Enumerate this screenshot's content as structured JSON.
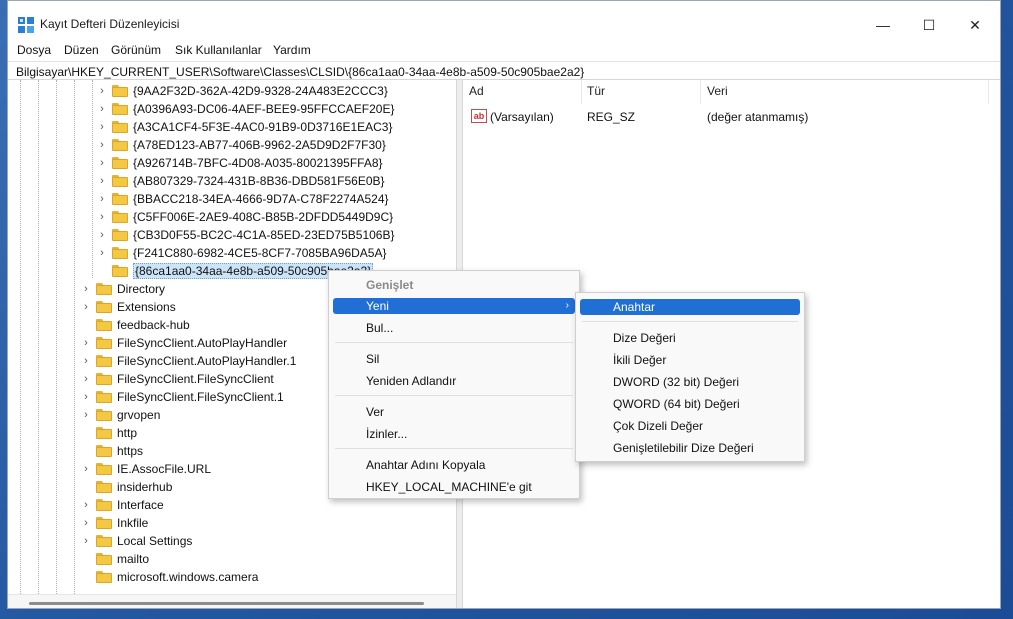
{
  "window": {
    "title": "Kayıt Defteri Düzenleyicisi"
  },
  "controls": {
    "minimize": "—",
    "maximize": "☐",
    "close": "✕"
  },
  "menu": [
    "Dosya",
    "Düzen",
    "Görünüm",
    "Sık Kullanılanlar",
    "Yardım"
  ],
  "address": "Bilgisayar\\HKEY_CURRENT_USER\\Software\\Classes\\CLSID\\{86ca1aa0-34aa-4e8b-a509-50c905bae2a2}",
  "tree": {
    "child_items": [
      "{9AA2F32D-362A-42D9-9328-24A483E2CCC3}",
      "{A0396A93-DC06-4AEF-BEE9-95FFCCAEF20E}",
      "{A3CA1CF4-5F3E-4AC0-91B9-0D3716E1EAC3}",
      "{A78ED123-AB77-406B-9962-2A5D9D2F7F30}",
      "{A926714B-7BFC-4D08-A035-80021395FFA8}",
      "{AB807329-7324-431B-8B36-DBD581F56E0B}",
      "{BBACC218-34EA-4666-9D7A-C78F2274A524}",
      "{C5FF006E-2AE9-408C-B85B-2DFDD5449D9C}",
      "{CB3D0F55-BC2C-4C1A-85ED-23ED75B5106B}",
      "{F241C880-6982-4CE5-8CF7-7085BA96DA5A}"
    ],
    "selected": "{86ca1aa0-34aa-4e8b-a509-50c905bae2a2}",
    "top_items": [
      {
        "label": "Directory",
        "expandable": true
      },
      {
        "label": "Extensions",
        "expandable": true
      },
      {
        "label": "feedback-hub",
        "expandable": false
      },
      {
        "label": "FileSyncClient.AutoPlayHandler",
        "expandable": true
      },
      {
        "label": "FileSyncClient.AutoPlayHandler.1",
        "expandable": true
      },
      {
        "label": "FileSyncClient.FileSyncClient",
        "expandable": true
      },
      {
        "label": "FileSyncClient.FileSyncClient.1",
        "expandable": true
      },
      {
        "label": "grvopen",
        "expandable": true
      },
      {
        "label": "http",
        "expandable": false
      },
      {
        "label": "https",
        "expandable": false
      },
      {
        "label": "IE.AssocFile.URL",
        "expandable": true
      },
      {
        "label": "insiderhub",
        "expandable": false
      },
      {
        "label": "Interface",
        "expandable": true
      },
      {
        "label": "Inkfile",
        "expandable": true
      },
      {
        "label": "Local Settings",
        "expandable": true
      },
      {
        "label": "mailto",
        "expandable": false
      },
      {
        "label": "microsoft.windows.camera",
        "expandable": false
      }
    ]
  },
  "list": {
    "headers": {
      "name": "Ad",
      "type": "Tür",
      "data": "Veri"
    },
    "rows": [
      {
        "name": "(Varsayılan)",
        "type": "REG_SZ",
        "data": "(değer atanmamış)",
        "icon": "ab-string-icon"
      }
    ]
  },
  "context_menu": {
    "expand": "Genişlet",
    "new": "Yeni",
    "find": "Bul...",
    "delete": "Sil",
    "rename": "Yeniden Adlandır",
    "export": "Ver",
    "permissions": "İzinler...",
    "copy_key_name": "Anahtar Adını Kopyala",
    "goto_hklm": "HKEY_LOCAL_MACHINE'e git"
  },
  "submenu": {
    "key": "Anahtar",
    "string": "Dize Değeri",
    "binary": "İkili Değer",
    "dword": "DWORD (32 bit) Değeri",
    "qword": "QWORD (64 bit) Değeri",
    "multi_string": "Çok Dizeli Değer",
    "expandable_string": "Genişletilebilir Dize Değeri"
  },
  "colors": {
    "highlight": "#1f6fd4",
    "folder": "#f4c842",
    "selection": "#cce4f7"
  }
}
